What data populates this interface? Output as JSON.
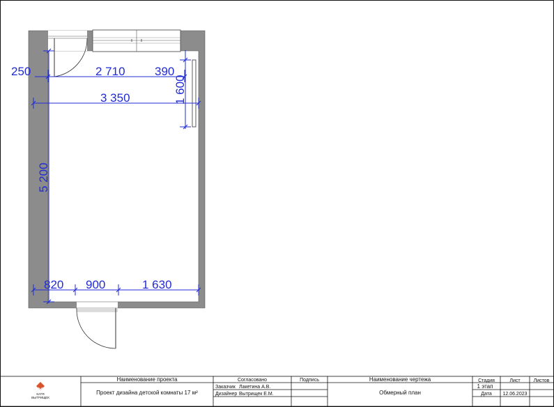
{
  "drawing": {
    "dimensions": {
      "top_left": "250",
      "top_mid": "2 710",
      "top_right": "390",
      "overall_width": "3 350",
      "window_height": "1 600",
      "room_length": "5 200",
      "bottom_left": "820",
      "bottom_door": "900",
      "bottom_right": "1 630"
    }
  },
  "title_block": {
    "logo_text_1": "КАТЯ",
    "logo_text_2": "ВЫТРИЩЕК",
    "project_name_header": "Наименование проекта",
    "project_name": "Проект дизайна детской комнаты 17 м²",
    "approved_header": "Согласовано",
    "signature_header": "Подпись",
    "customer_label": "Заказчик",
    "customer_name": "Лакетина А.В.",
    "designer_label": "Дизайнер",
    "designer_name": "Вытрищек Е.М.",
    "drawing_name_header": "Наименование чертежа",
    "drawing_name": "Обмерный план",
    "stage_header": "Стадия",
    "stage_value": "1 этап",
    "sheet_header": "Лист",
    "sheets_header": "Листов",
    "date_label": "Дата",
    "date_value": "12.06.2023"
  },
  "colors": {
    "wall_fill": "#8c8c8c",
    "dimension": "#1f2bd6",
    "line": "#111111",
    "logo_accent": "#d9532c"
  }
}
